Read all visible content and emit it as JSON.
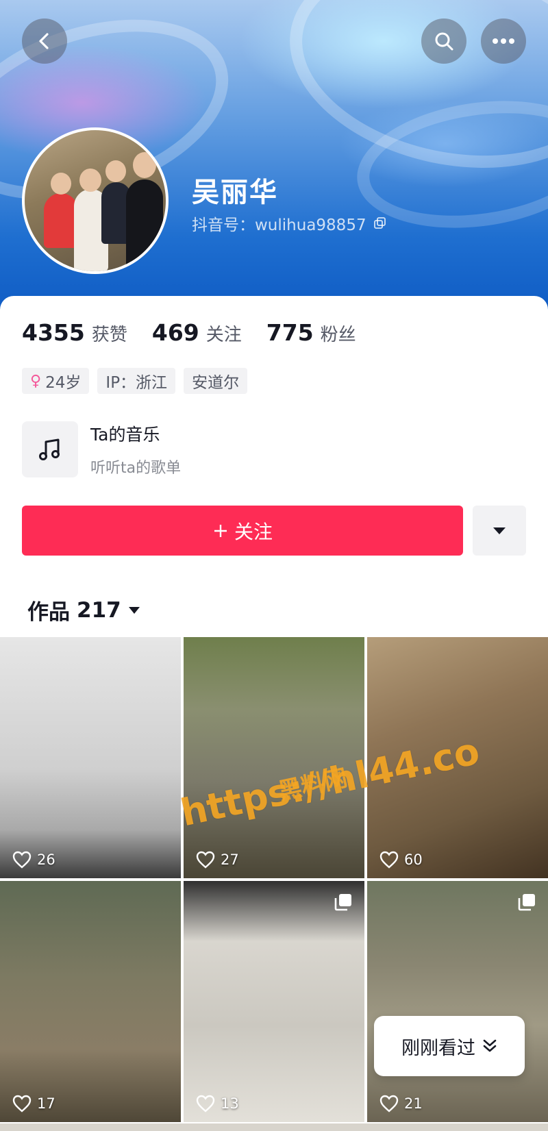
{
  "profile": {
    "name": "吴丽华",
    "douyin_id_label": "抖音号：",
    "douyin_id": "wulihua98857"
  },
  "stats": [
    {
      "value": "4355",
      "label": "获赞"
    },
    {
      "value": "469",
      "label": "关注"
    },
    {
      "value": "775",
      "label": "粉丝"
    }
  ],
  "tags": {
    "age": "24岁",
    "ip": "IP：浙江",
    "location": "安道尔"
  },
  "music": {
    "title": "Ta的音乐",
    "subtitle": "听听ta的歌单"
  },
  "actions": {
    "follow_label": "关注"
  },
  "works": {
    "label": "作品",
    "count": "217"
  },
  "videos": [
    {
      "likes": "26",
      "multi": false
    },
    {
      "likes": "27",
      "multi": false
    },
    {
      "likes": "60",
      "multi": false
    },
    {
      "likes": "17",
      "multi": false
    },
    {
      "likes": "13",
      "multi": true
    },
    {
      "likes": "21",
      "multi": true
    }
  ],
  "watermark": {
    "top": "黑料网",
    "url": "https://hl44.co"
  },
  "just_watched_label": "刚刚看过",
  "colors": {
    "accent": "#fe2c55",
    "header_blue": "#1f6fd0",
    "female": "#f4599a"
  }
}
